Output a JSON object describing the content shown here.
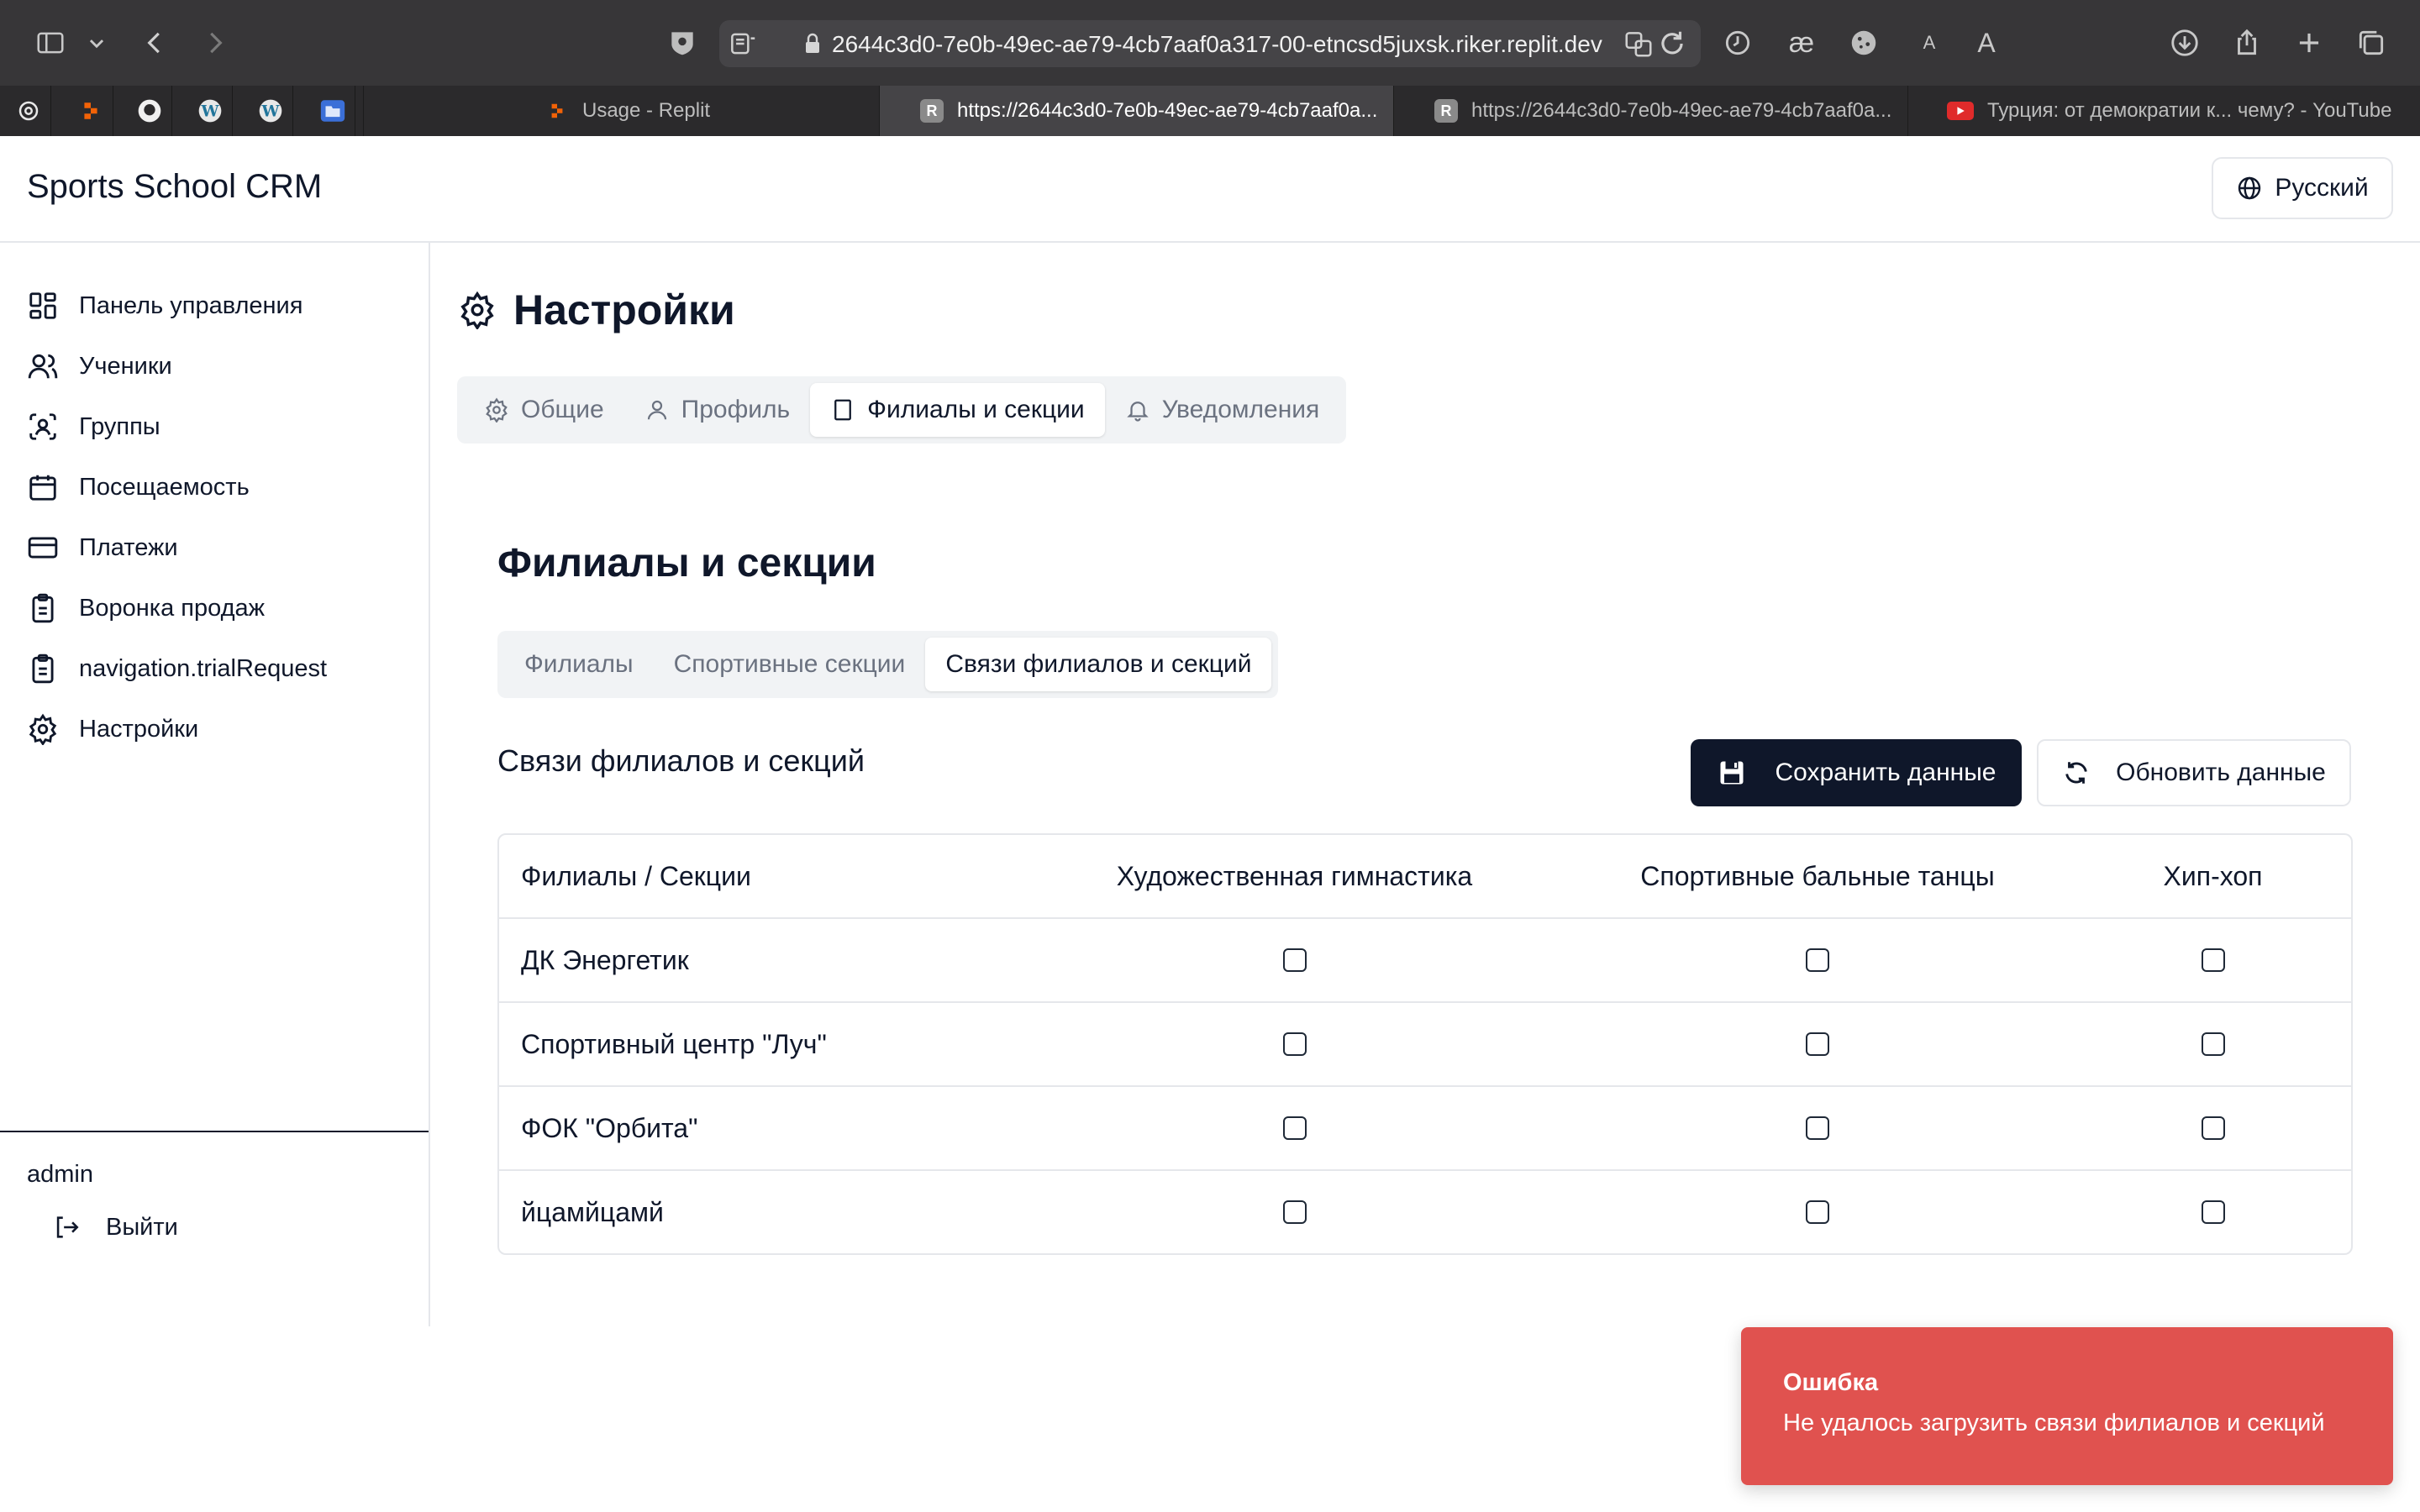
{
  "browser": {
    "url": "2644c3d0-7e0b-49ec-ae79-4cb7aaf0a317-00-etncsd5juxsk.riker.replit.dev",
    "tabs": [
      {
        "title": "Usage - Replit",
        "active": false
      },
      {
        "title": "https://2644c3d0-7e0b-49ec-ae79-4cb7aaf0a...",
        "active": true
      },
      {
        "title": "https://2644c3d0-7e0b-49ec-ae79-4cb7aaf0a...",
        "active": false
      },
      {
        "title": "Турция: от демократии к... чему? - YouTube",
        "active": false
      }
    ],
    "reader_small": "A",
    "reader_large": "A"
  },
  "app": {
    "title": "Sports School CRM",
    "language": "Русский"
  },
  "sidebar": {
    "items": [
      {
        "label": "Панель управления",
        "icon": "dashboard-icon"
      },
      {
        "label": "Ученики",
        "icon": "users-icon"
      },
      {
        "label": "Группы",
        "icon": "groups-icon"
      },
      {
        "label": "Посещаемость",
        "icon": "calendar-icon"
      },
      {
        "label": "Платежи",
        "icon": "credit-card-icon"
      },
      {
        "label": "Воронка продаж",
        "icon": "clipboard-icon"
      },
      {
        "label": "navigation.trialRequest",
        "icon": "clipboard-icon"
      },
      {
        "label": "Настройки",
        "icon": "gear-icon"
      }
    ],
    "user": "admin",
    "logout": "Выйти"
  },
  "page": {
    "title": "Настройки",
    "tabs": [
      {
        "label": "Общие",
        "icon": "gear-icon",
        "active": false
      },
      {
        "label": "Профиль",
        "icon": "user-icon",
        "active": false
      },
      {
        "label": "Филиалы и секции",
        "icon": "building-icon",
        "active": true
      },
      {
        "label": "Уведомления",
        "icon": "bell-icon",
        "active": false
      }
    ]
  },
  "section": {
    "title": "Филиалы и секции",
    "subtabs": [
      {
        "label": "Филиалы",
        "active": false
      },
      {
        "label": "Спортивные секции",
        "active": false
      },
      {
        "label": "Связи филиалов и секций",
        "active": true
      }
    ],
    "card_title": "Связи филиалов и секций",
    "save_label": "Сохранить данные",
    "refresh_label": "Обновить данные"
  },
  "matrix": {
    "corner": "Филиалы / Секции",
    "columns": [
      "Художественная гимнастика",
      "Спортивные бальные танцы",
      "Хип-хоп"
    ],
    "rows": [
      {
        "branch": "ДК Энергетик",
        "checked": [
          false,
          false,
          false
        ]
      },
      {
        "branch": "Спортивный центр \"Луч\"",
        "checked": [
          false,
          false,
          false
        ]
      },
      {
        "branch": "ФОК \"Орбита\"",
        "checked": [
          false,
          false,
          false
        ]
      },
      {
        "branch": "йцамйцамй",
        "checked": [
          false,
          false,
          false
        ]
      }
    ]
  },
  "toast": {
    "title": "Ошибка",
    "message": "Не удалось загрузить связи филиалов и секций",
    "color": "#e0524f"
  }
}
